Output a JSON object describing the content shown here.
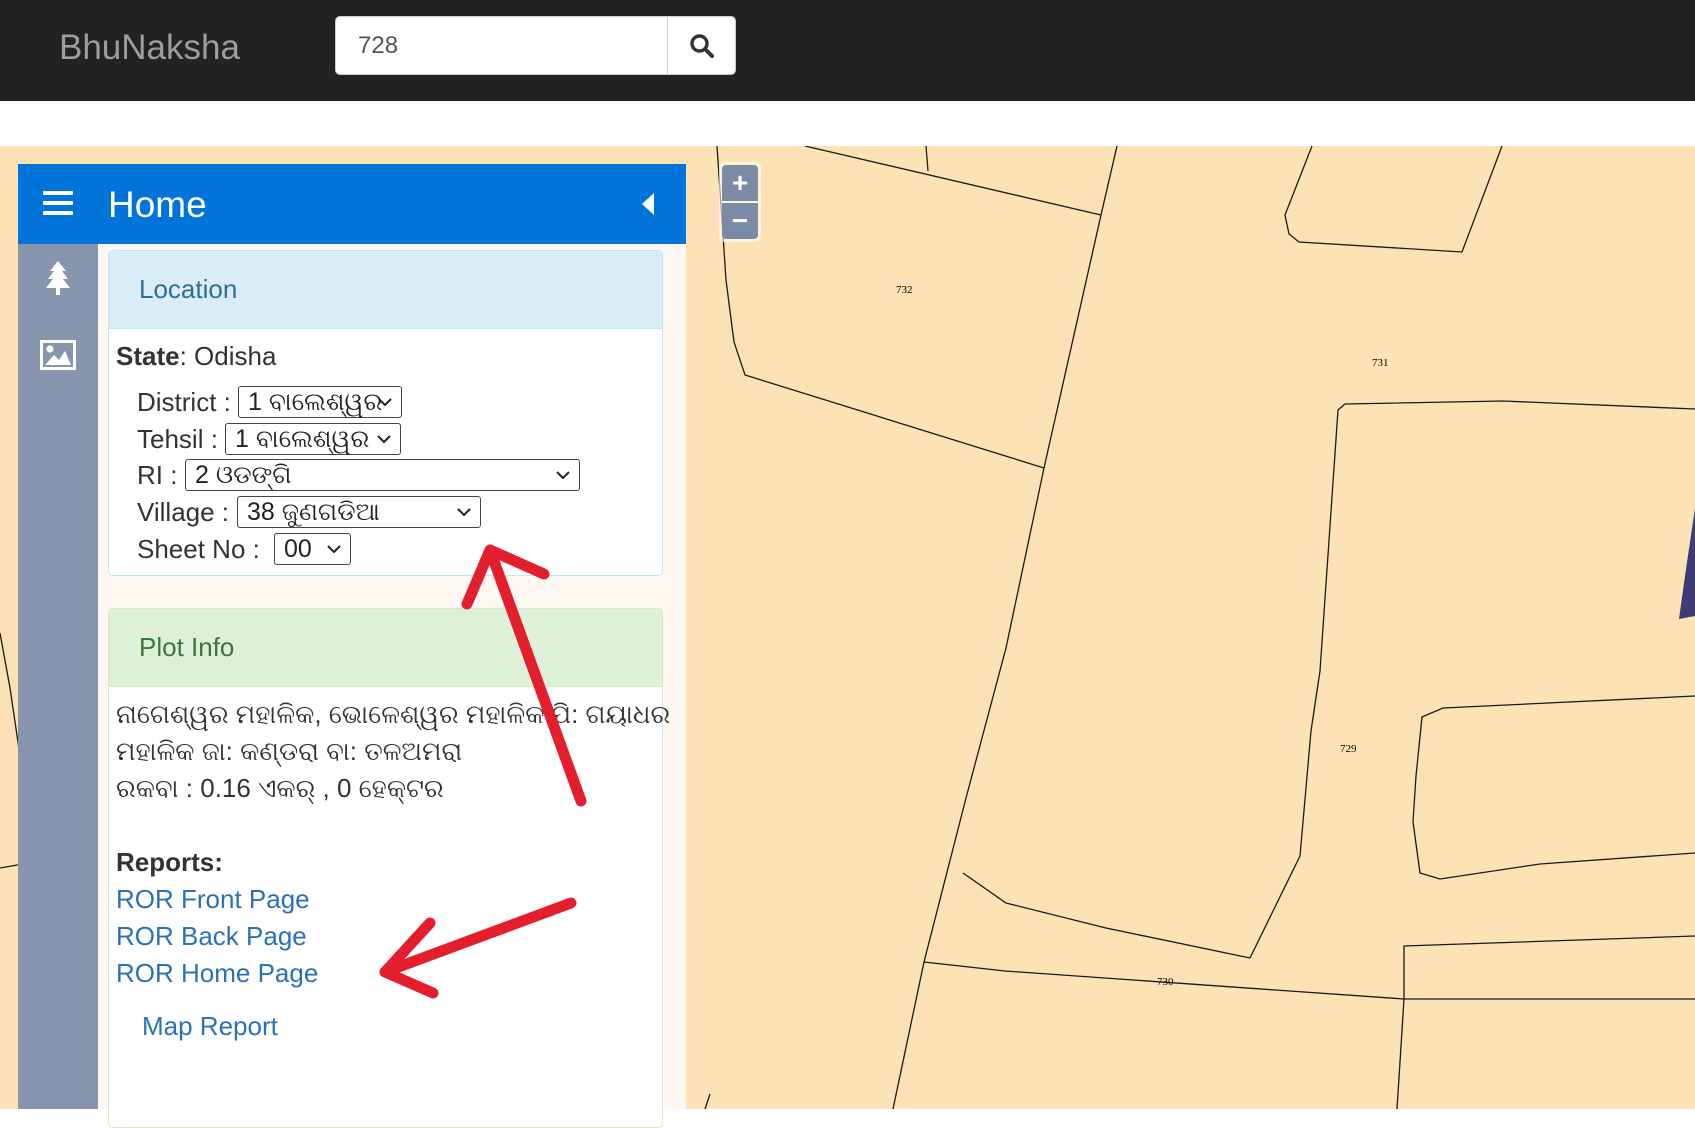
{
  "header": {
    "brand": "BhuNaksha",
    "search_value": "728",
    "search_icon": "search-icon"
  },
  "map": {
    "zoom_in": "+",
    "zoom_out": "−",
    "plot_labels": [
      "732",
      "731",
      "729",
      "730"
    ]
  },
  "sidebar": {
    "title": "Home",
    "tab_icons": [
      "tree-icon",
      "image-icon"
    ],
    "location": {
      "heading": "Location",
      "state_label": "State",
      "state_value": ": Odisha",
      "district_label": "District :",
      "district_value": "1 ବାଲେଶ୍ୱର",
      "tehsil_label": "Tehsil :",
      "tehsil_value": "1 ବାଲେଶ୍ୱର",
      "ri_label": "RI :",
      "ri_value": "2 ଓଡଙ୍ଗି",
      "village_label": "Village :",
      "village_value": "38 ଜୁଣଗଡିଆ",
      "sheet_label": "Sheet No  :",
      "sheet_value": "00"
    },
    "plot_info": {
      "heading": "Plot Info",
      "owner_line1": "ନାଗେଶ୍ୱର ମହାଳିକ, ଭୋଳେଶ୍ୱର ମହାଳିକ ପି: ଗୟାଧର",
      "owner_line2": "ମହାଳିକ ଜା: କଣ୍ଡରା ବା: ତଳଅମରା",
      "area": "ରକବା : 0.16 ଏକର୍ , 0 ହେକ୍ଟର",
      "reports_label": "Reports:",
      "ror_front": "ROR Front Page",
      "ror_back": "ROR Back Page",
      "ror_home": "ROR Home Page",
      "map_report": "Map Report"
    }
  },
  "colors": {
    "topbar": "#222222",
    "map_background": "#fce2b5",
    "sidebar_header": "#0074d9",
    "annotation_arrow": "#e31e2d",
    "link": "#2a72b5"
  }
}
